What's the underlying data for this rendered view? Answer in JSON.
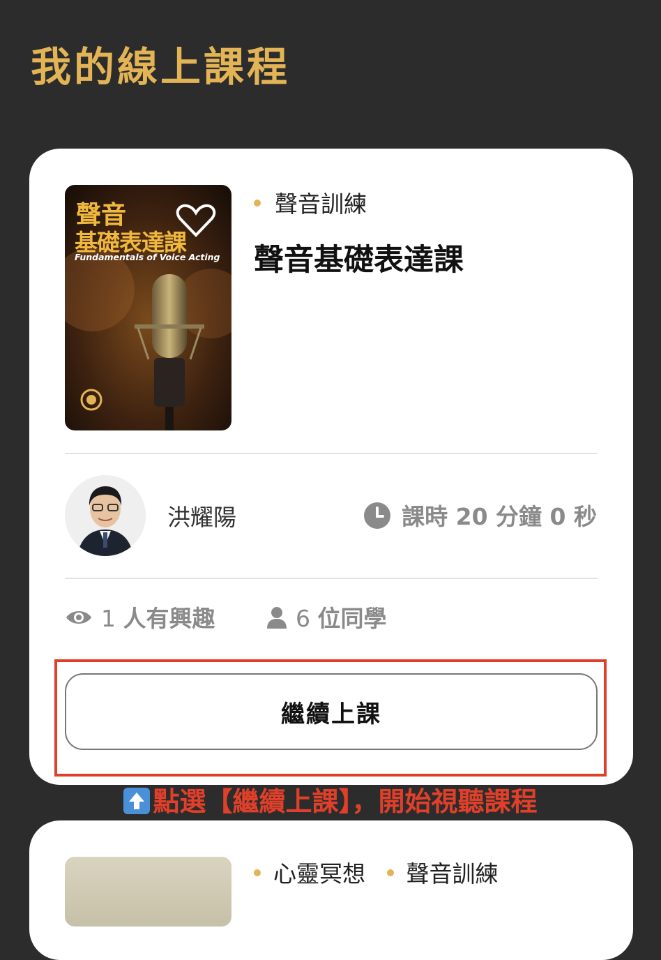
{
  "page": {
    "title": "我的線上課程"
  },
  "course": {
    "cover": {
      "title_line1": "聲音",
      "title_line2": "基礎表達課",
      "subtitle": "Fundamentals of Voice Acting"
    },
    "category": "聲音訓練",
    "title": "聲音基礎表達課",
    "teacher": "洪耀陽",
    "duration": "課時 20 分鐘 0 秒",
    "interested_count": "1",
    "interested_label": "人有興趣",
    "students_count": "6",
    "students_label": "位同學",
    "continue_label": "繼續上課"
  },
  "hint": "點選【繼續上課】，開始視聽課程",
  "next_course": {
    "categories": [
      "心靈冥想",
      "聲音訓練"
    ]
  },
  "colors": {
    "accent": "#e2b456",
    "highlight": "#e0402a",
    "background": "#2c2c2c"
  },
  "icons": [
    "heart-icon",
    "clock-icon",
    "eye-icon",
    "user-icon",
    "up-arrow-icon"
  ]
}
